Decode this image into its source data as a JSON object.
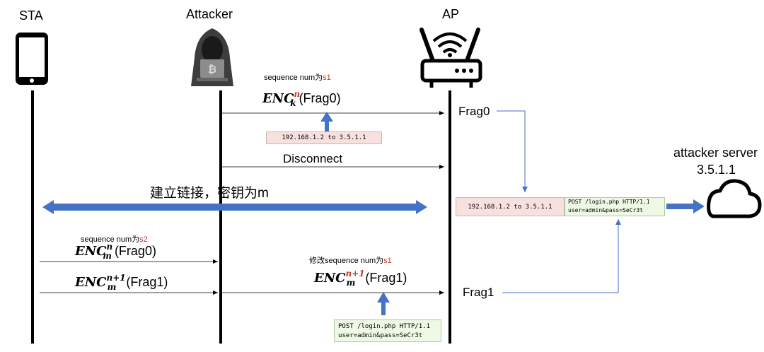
{
  "actors": {
    "sta": "STA",
    "attacker": "Attacker",
    "ap": "AP",
    "server_name": "attacker server",
    "server_ip": "3.5.1.1"
  },
  "messages": {
    "seq_s1_prefix": "sequence num为",
    "seq_s1_value": "s1",
    "enc_k_base": "ENC",
    "enc_k_sup": "n",
    "enc_k_sub": "k",
    "frag0": "(Frag0)",
    "frag0_ap": "Frag0",
    "disconnect": "Disconnect",
    "establish": "建立链接，密钥为m",
    "seq_s2_prefix": "sequence num为",
    "seq_s2_value": "s2",
    "enc_m_sup": "n",
    "enc_m_sub": "m",
    "enc_m1_sup": "n+1",
    "modify_prefix": "修改sequence num为",
    "modify_value": "s1",
    "frag1": "(Frag1)",
    "frag1_ap": "Frag1"
  },
  "boxes": {
    "ip_header": "192.168.1.2 to 3.5.1.1",
    "ip_header_server": "192.168.1.2 to 3.5.1.1",
    "http_line1": "POST /login.php HTTP/1.1",
    "http_line2": "user=admin&pass=SeCr3t",
    "http_server_line1": "POST /login.php HTTP/1.1",
    "http_server_line2": "user=admin&pass=SeCr3t"
  },
  "colors": {
    "accent_blue": "#4472c4",
    "highlight_red": "#c0392b",
    "pink_box": "#f8e0de",
    "green_box": "#eef8e4"
  },
  "icons": [
    "phone-icon",
    "hacker-icon",
    "router-icon",
    "cloud-icon"
  ]
}
